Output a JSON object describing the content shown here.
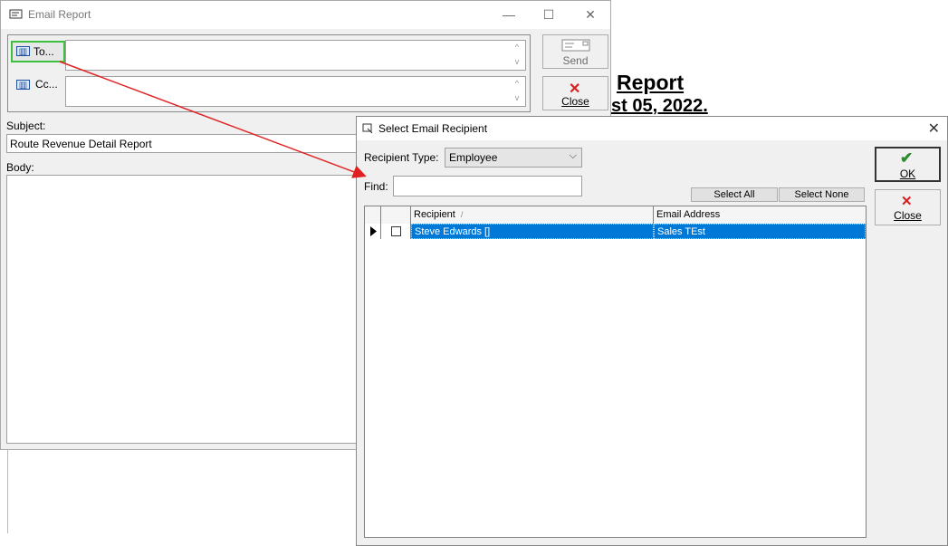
{
  "report_background": {
    "title_fragment": "Report",
    "date_fragment": "st 05, 2022."
  },
  "email_window": {
    "title": "Email Report",
    "controls": {
      "minimize": "—",
      "maximize": "☐",
      "close": "✕"
    },
    "to_label": "To...",
    "cc_label": "Cc...",
    "to_value": "",
    "cc_value": "",
    "send_label": "Send",
    "close_label": "Close",
    "subject_label": "Subject:",
    "subject_value": "Route Revenue Detail Report",
    "body_label": "Body:",
    "body_value": ""
  },
  "recipient_dialog": {
    "title": "Select Email Recipient",
    "recipient_type_label": "Recipient Type:",
    "recipient_type_value": "Employee",
    "find_label": "Find:",
    "find_value": "",
    "select_all_label": "Select All",
    "select_none_label": "Select None",
    "columns": [
      "Recipient",
      "Email Address"
    ],
    "sort_indicator": "/",
    "rows": [
      {
        "recipient": "Steve Edwards []",
        "email": "Sales TEst",
        "checked": false,
        "selected": true
      }
    ],
    "ok_label": "OK",
    "close_label": "Close"
  },
  "annotation": {
    "highlight_color": "#3fbf3f",
    "arrow_color": "#e02020"
  }
}
